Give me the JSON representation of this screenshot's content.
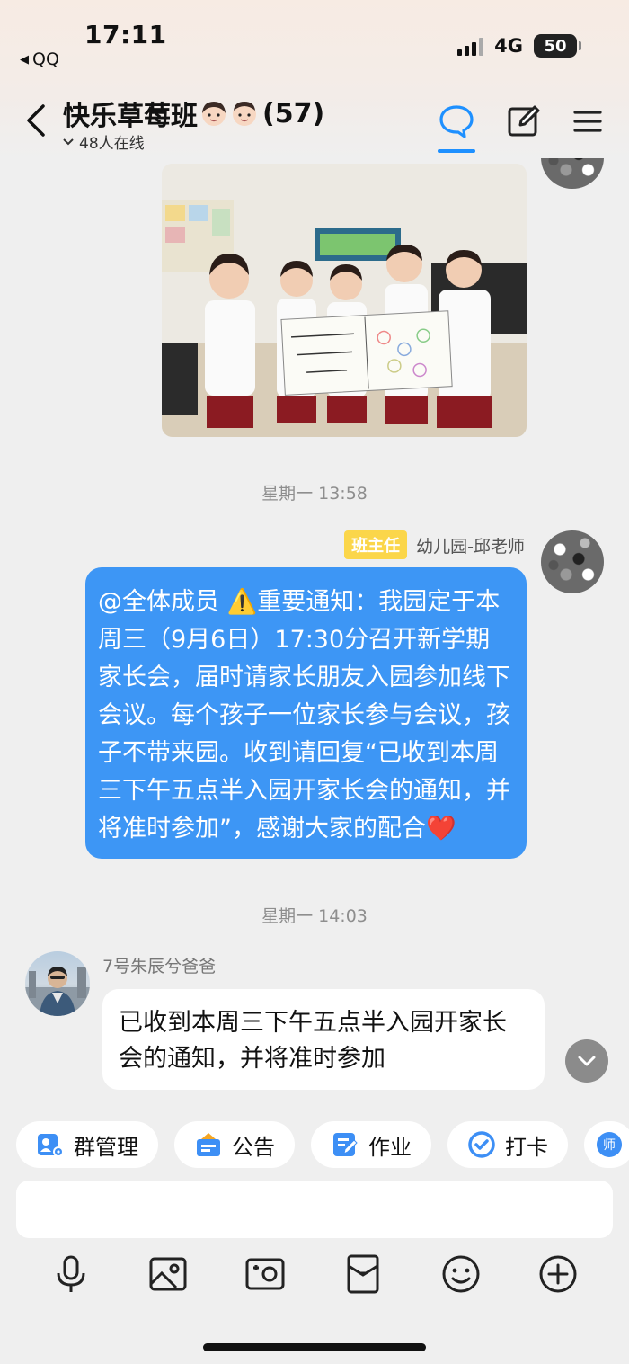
{
  "status_bar": {
    "time": "17:11",
    "back_app": "QQ",
    "network": "4G",
    "battery": "50"
  },
  "header": {
    "group_name": "快乐草莓班",
    "member_count": "(57)",
    "online_text": "48人在线",
    "accent_color": "#1e90ff"
  },
  "messages": {
    "ts1": "星期一 13:58",
    "teacher_badge": "班主任",
    "teacher_name": "幼儿园-邱老师",
    "notice_text": "@全体成员 ⚠️重要通知：我园定于本周三（9月6日）17:30分召开新学期家长会，届时请家长朋友入园参加线下会议。每个孩子一位家长参与会议，孩子不带来园。收到请回复“已收到本周三下午五点半入园开家长会的通知，并将准时参加”，感谢大家的配合❤️",
    "ts2": "星期一 14:03",
    "reply_sender": "7号朱辰兮爸爸",
    "reply_text": "已收到本周三下午五点半入园开家长会的通知，并将准时参加",
    "blue_bubble_color": "#3d96f5"
  },
  "quick_actions": [
    {
      "label": "群管理",
      "icon": "group-manage-icon"
    },
    {
      "label": "公告",
      "icon": "announcement-icon"
    },
    {
      "label": "作业",
      "icon": "homework-icon"
    },
    {
      "label": "打卡",
      "icon": "checkin-icon"
    },
    {
      "label": "师",
      "icon": "teacher-icon"
    }
  ],
  "bottom_toolbar": [
    "microphone-icon",
    "image-icon",
    "camera-icon",
    "red-packet-icon",
    "emoji-icon",
    "plus-icon"
  ]
}
